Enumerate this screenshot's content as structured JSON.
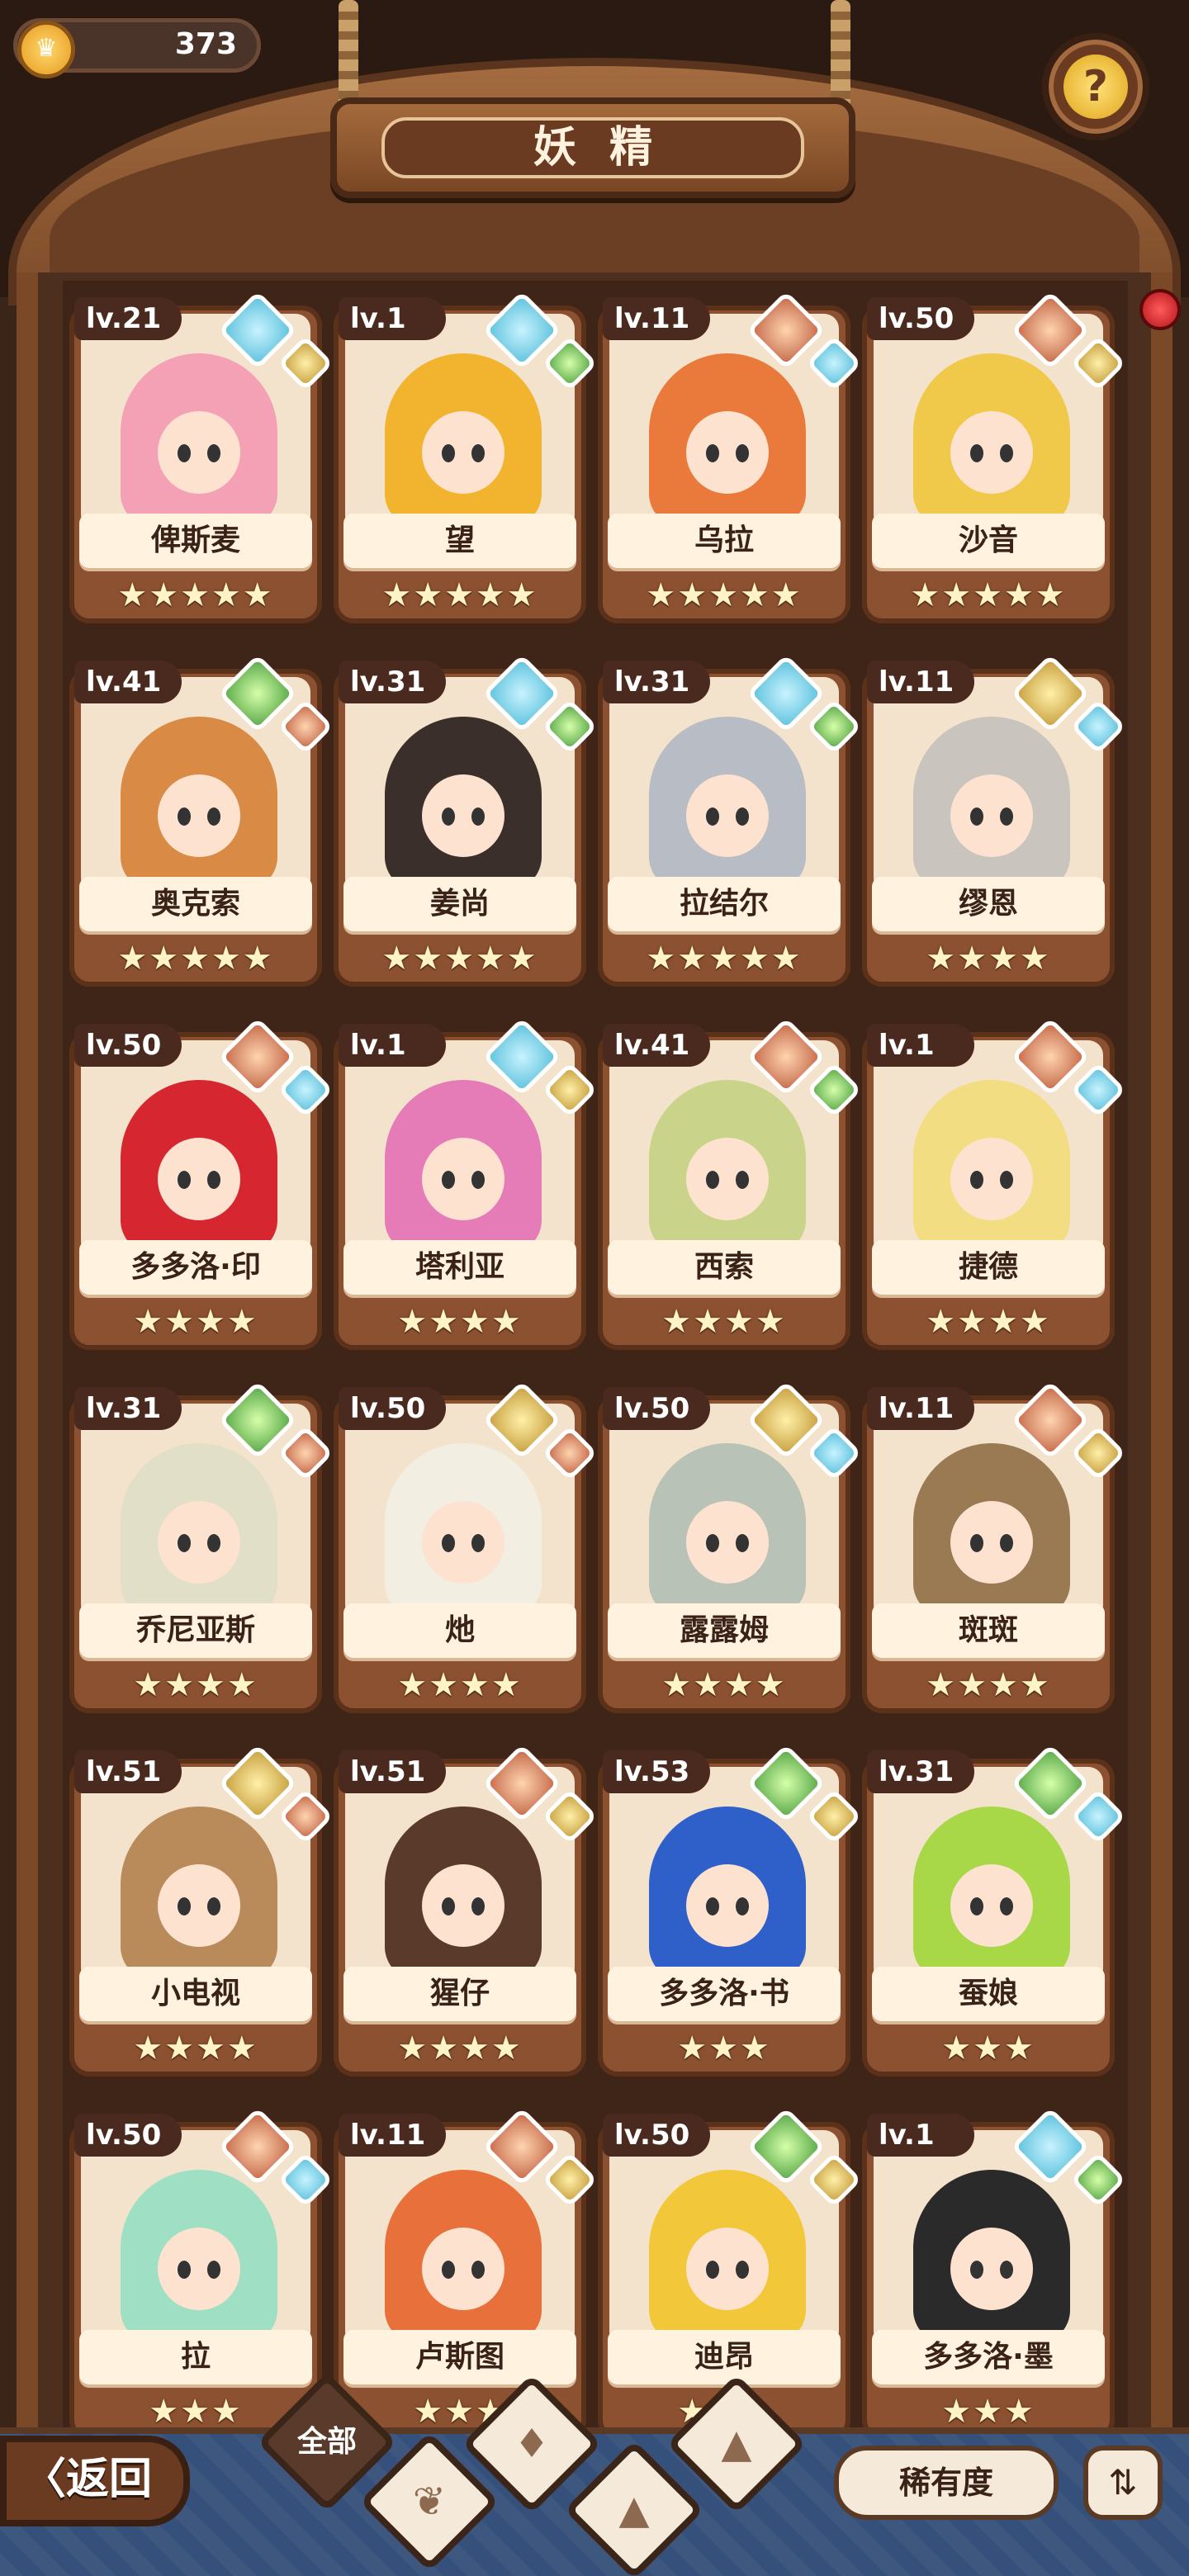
{
  "header": {
    "title": "妖精",
    "coins": "373",
    "help_symbol": "?"
  },
  "fairies": [
    {
      "level": "lv.21",
      "name": "俾斯麦",
      "stars": "★★★★★",
      "main": "water",
      "sub": "earth",
      "hair": "#f4a0b5"
    },
    {
      "level": "lv.1",
      "name": "望",
      "stars": "★★★★★",
      "main": "water",
      "sub": "leaf",
      "hair": "#f2b42e"
    },
    {
      "level": "lv.11",
      "name": "乌拉",
      "stars": "★★★★★",
      "main": "fire",
      "sub": "water",
      "hair": "#e97a3b"
    },
    {
      "level": "lv.50",
      "name": "沙音",
      "stars": "★★★★★",
      "main": "fire",
      "sub": "earth",
      "hair": "#f0c84a"
    },
    {
      "level": "lv.41",
      "name": "奥克索",
      "stars": "★★★★★",
      "main": "leaf",
      "sub": "fire",
      "hair": "#d98a45"
    },
    {
      "level": "lv.31",
      "name": "姜尚",
      "stars": "★★★★★",
      "main": "water",
      "sub": "leaf",
      "hair": "#3a2f2a"
    },
    {
      "level": "lv.31",
      "name": "拉结尔",
      "stars": "★★★★★",
      "main": "water",
      "sub": "leaf",
      "hair": "#b8bcc4"
    },
    {
      "level": "lv.11",
      "name": "缪恩",
      "stars": "★★★★",
      "main": "earth",
      "sub": "water",
      "hair": "#c9c4bd"
    },
    {
      "level": "lv.50",
      "name": "多多洛·印",
      "stars": "★★★★",
      "main": "fire",
      "sub": "water",
      "hair": "#d62630"
    },
    {
      "level": "lv.1",
      "name": "塔利亚",
      "stars": "★★★★",
      "main": "water",
      "sub": "earth",
      "hair": "#e57cb8"
    },
    {
      "level": "lv.41",
      "name": "西索",
      "stars": "★★★★",
      "main": "fire",
      "sub": "leaf",
      "hair": "#c9d48a"
    },
    {
      "level": "lv.1",
      "name": "捷德",
      "stars": "★★★★",
      "main": "fire",
      "sub": "water",
      "hair": "#f2dd82"
    },
    {
      "level": "lv.31",
      "name": "乔尼亚斯",
      "stars": "★★★★",
      "main": "leaf",
      "sub": "fire",
      "hair": "#e2dfc8"
    },
    {
      "level": "lv.50",
      "name": "灺",
      "stars": "★★★★",
      "main": "earth",
      "sub": "fire",
      "hair": "#f2efe2"
    },
    {
      "level": "lv.50",
      "name": "露露姆",
      "stars": "★★★★",
      "main": "earth",
      "sub": "water",
      "hair": "#b9c2b6"
    },
    {
      "level": "lv.11",
      "name": "斑斑",
      "stars": "★★★★",
      "main": "fire",
      "sub": "earth",
      "hair": "#9a7a52"
    },
    {
      "level": "lv.51",
      "name": "小电视",
      "stars": "★★★★",
      "main": "earth",
      "sub": "fire",
      "hair": "#b98a5a"
    },
    {
      "level": "lv.51",
      "name": "猩仔",
      "stars": "★★★★",
      "main": "fire",
      "sub": "earth",
      "hair": "#5a3a2a"
    },
    {
      "level": "lv.53",
      "name": "多多洛·书",
      "stars": "★★★",
      "main": "leaf",
      "sub": "earth",
      "hair": "#2f5fc9"
    },
    {
      "level": "lv.31",
      "name": "蚕娘",
      "stars": "★★★",
      "main": "leaf",
      "sub": "water",
      "hair": "#a8d848"
    },
    {
      "level": "lv.50",
      "name": "拉",
      "stars": "★★★",
      "main": "fire",
      "sub": "water",
      "hair": "#9fe0c4"
    },
    {
      "level": "lv.11",
      "name": "卢斯图",
      "stars": "★★★",
      "main": "fire",
      "sub": "earth",
      "hair": "#e8703a"
    },
    {
      "level": "lv.50",
      "name": "迪昂",
      "stars": "★★★",
      "main": "leaf",
      "sub": "earth",
      "hair": "#f2c83a"
    },
    {
      "level": "lv.1",
      "name": "多多洛·墨",
      "stars": "★★★",
      "main": "water",
      "sub": "leaf",
      "hair": "#2a2a2a"
    }
  ],
  "bottom": {
    "back_label": "〈返回",
    "filter_all": "全部",
    "rarity_label": "稀有度",
    "sort_icon": "⇅"
  },
  "icons": {
    "coin": "crown-coin-icon",
    "help": "question-mark-icon",
    "leaf": "sprout-icon",
    "water": "water-drop-icon",
    "earth": "mountain-icon",
    "fire": "volcano-icon"
  }
}
